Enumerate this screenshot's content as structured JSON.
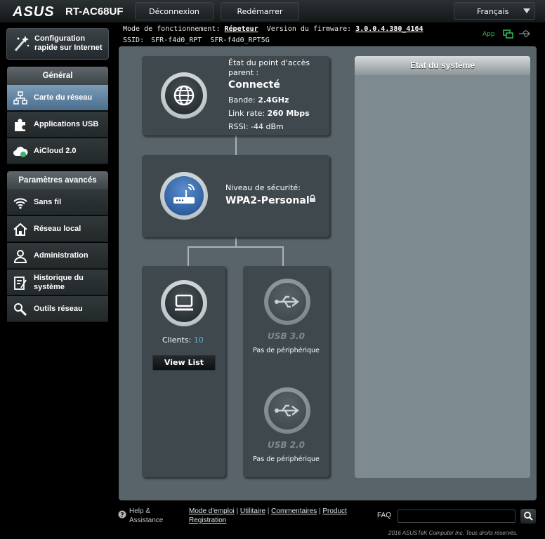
{
  "header": {
    "logo": "ASUS",
    "model": "RT-AC68UF",
    "logout": "Déconnexion",
    "reboot": "Redémarrer",
    "language": "Français"
  },
  "info": {
    "mode_label": "Mode de fonctionnement:",
    "mode_value": "Répeteur",
    "firmware_label": "Version du firmware:",
    "firmware_value": "3.0.0.4.380_4164",
    "ssid_label": "SSID:",
    "ssid_values": "SFR-f4d0_RPT  SFR-f4d0_RPT5G",
    "app_label": "App"
  },
  "sidebar": {
    "quick_setup": "Configuration rapide sur Internet",
    "general_title": "Général",
    "general_items": [
      {
        "label": "Carte du réseau",
        "icon": "network-map-icon"
      },
      {
        "label": "Applications USB",
        "icon": "puzzle-icon"
      },
      {
        "label": "AiCloud 2.0",
        "icon": "cloud-icon"
      }
    ],
    "advanced_title": "Paramètres avancés",
    "advanced_items": [
      {
        "label": "Sans fil",
        "icon": "wifi-icon"
      },
      {
        "label": "Réseau local",
        "icon": "home-icon"
      },
      {
        "label": "Administration",
        "icon": "person-icon"
      },
      {
        "label": "Historique du système",
        "icon": "log-icon"
      },
      {
        "label": "Outils réseau",
        "icon": "tools-icon"
      }
    ]
  },
  "internet": {
    "title": "État du point d'accès parent :",
    "status": "Connecté",
    "band_label": "Bande:",
    "band": "2.4GHz",
    "rate_label": "Link rate:",
    "rate": "260 Mbps",
    "rssi_label": "RSSI:",
    "rssi": "-44 dBm"
  },
  "router": {
    "security_label": "Niveau de sécurité:",
    "security": "WPA2-Personal"
  },
  "clients": {
    "label": "Clients:",
    "count": "10",
    "button": "View List"
  },
  "usb": [
    {
      "label": "USB 3.0",
      "status": "Pas de périphérique"
    },
    {
      "label": "USB 2.0",
      "status": "Pas de périphérique"
    }
  ],
  "system": {
    "title": "Etat du système"
  },
  "footer": {
    "help1": "Help &",
    "help2": "Assistance",
    "link1": "Mode d'emploi",
    "link2": "Utilitaire",
    "link3": "Commentaires",
    "link4a": "Product",
    "link4b": "Registration",
    "faq": "FAQ",
    "copyright": "2016 ASUSTeK Computer Inc. Tous droits réservés."
  },
  "colors": {
    "accent": "#4b6e8e",
    "clients_count": "#5fb0d8",
    "app_green": "#34c05a"
  }
}
